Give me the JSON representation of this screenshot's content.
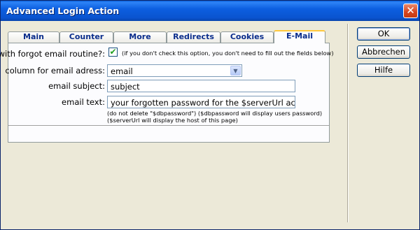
{
  "window": {
    "title": "Advanced Login Action",
    "close_glyph": "✕"
  },
  "tabs": [
    {
      "label": "Main",
      "active": false
    },
    {
      "label": "Counter",
      "active": false
    },
    {
      "label": "More",
      "active": false
    },
    {
      "label": "Redirects",
      "active": false
    },
    {
      "label": "Cookies",
      "active": false
    },
    {
      "label": "E-Mail",
      "active": true
    }
  ],
  "form": {
    "forgot_label": "with forgot email routine?:",
    "forgot_checked": true,
    "forgot_hint": "(if you don't check this option, you don't need to fill out the fields below)",
    "column_label": "column for email adress:",
    "column_value": "email",
    "subject_label": "email subject:",
    "subject_value": "subject",
    "text_label": "email text:",
    "text_value": "your forgotten password for the $serverUrl account: $dbpassword",
    "note_line1": "(do not delete \"$dbpassword\") ($dbpassword will display users password)",
    "note_line2": "($serverUrl will display the host of this page)"
  },
  "buttons": {
    "ok": "OK",
    "cancel": "Abbrechen",
    "help": "Hilfe"
  },
  "icons": {
    "checkmark": "✔",
    "dropdown": "▼"
  },
  "colors": {
    "titlebar": "#0a53cf",
    "tab_text": "#0a2d8c",
    "active_tab_accent": "#ffc83c",
    "dialog_bg": "#ece9d8"
  }
}
